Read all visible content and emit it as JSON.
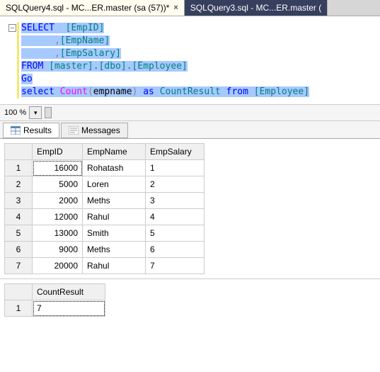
{
  "tabs": [
    {
      "label": "SQLQuery4.sql - MC...ER.master (sa (57))*",
      "active": true
    },
    {
      "label": "SQLQuery3.sql - MC...ER.master (",
      "active": false
    }
  ],
  "code": {
    "l1": {
      "kw": "SELECT",
      "sp": "  ",
      "o": "[EmpID]"
    },
    "l2": {
      "indent": "      ",
      "comma": ",",
      "o": "[EmpName]"
    },
    "l3": {
      "indent": "      ",
      "comma": ",",
      "o": "[EmpSalary]"
    },
    "l4": {
      "kw": "FROM",
      "sp": " ",
      "o": "[master].[dbo].[Employee]"
    },
    "l5": {
      "kw": "Go"
    },
    "l6": {
      "kw1": "select",
      "sp1": " ",
      "fn": "Count",
      "p1": "(",
      "arg": "empname",
      "p2": ") ",
      "kw2": "as",
      "sp2": " ",
      "alias": "CountResult",
      "sp3": " ",
      "kw3": "from",
      "sp4": " ",
      "tbl": "[Employee]"
    }
  },
  "zoom": "100 %",
  "resultTabs": {
    "results": "Results",
    "messages": "Messages"
  },
  "grid1": {
    "headers": [
      "EmpID",
      "EmpName",
      "EmpSalary"
    ],
    "rows": [
      {
        "n": "1",
        "c": [
          "16000",
          "Rohatash",
          "1"
        ]
      },
      {
        "n": "2",
        "c": [
          "5000",
          "Loren",
          "2"
        ]
      },
      {
        "n": "3",
        "c": [
          "2000",
          "Meths",
          "3"
        ]
      },
      {
        "n": "4",
        "c": [
          "12000",
          "Rahul",
          "4"
        ]
      },
      {
        "n": "5",
        "c": [
          "13000",
          "Smith",
          "5"
        ]
      },
      {
        "n": "6",
        "c": [
          "9000",
          "Meths",
          "6"
        ]
      },
      {
        "n": "7",
        "c": [
          "20000",
          "Rahul",
          "7"
        ]
      }
    ]
  },
  "grid2": {
    "headers": [
      "CountResult"
    ],
    "rows": [
      {
        "n": "1",
        "c": [
          "7"
        ]
      }
    ]
  },
  "chart_data": {
    "type": "table",
    "tables": [
      {
        "columns": [
          "EmpID",
          "EmpName",
          "EmpSalary"
        ],
        "rows": [
          [
            16000,
            "Rohatash",
            1
          ],
          [
            5000,
            "Loren",
            2
          ],
          [
            2000,
            "Meths",
            3
          ],
          [
            12000,
            "Rahul",
            4
          ],
          [
            13000,
            "Smith",
            5
          ],
          [
            9000,
            "Meths",
            6
          ],
          [
            20000,
            "Rahul",
            7
          ]
        ]
      },
      {
        "columns": [
          "CountResult"
        ],
        "rows": [
          [
            7
          ]
        ]
      }
    ]
  }
}
